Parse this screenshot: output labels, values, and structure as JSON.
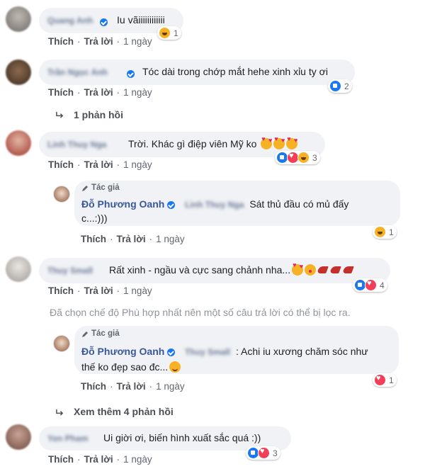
{
  "actions": {
    "like": "Thích",
    "reply": "Trả lời",
    "sep": "·"
  },
  "comments": [
    {
      "author": "Quang Anh",
      "text": "Iu vãiiiiiiiiiiii",
      "time": "1 ngày",
      "reaction_count": "1"
    },
    {
      "author": "Trần Ngọc Anh",
      "text": "Tóc dài trong chớp mắt hehe xinh xỉu ty ơi",
      "time": "1 ngày",
      "reaction_count": "2",
      "replies_link": "1 phản hồi"
    },
    {
      "author": "Linh Thuy Nga",
      "text": "Trời. Khác gì điệp viên Mỹ ko",
      "time": "1 ngày",
      "reaction_count": "3"
    },
    {
      "author": "Thuy Small",
      "text": "Rất xinh - ngầu và cực sang chảnh nha...",
      "time": "1 ngày",
      "reaction_count": "4"
    },
    {
      "author": "Yen Pham",
      "text": "Ui giời ơi, biến hình xuất sắc quá :))",
      "time": "1 ngày",
      "reaction_count": "3"
    }
  ],
  "replies": [
    {
      "tag": "Tác giả",
      "author": "Đỗ Phương Oanh",
      "mention": "Linh Thuy Nga",
      "text_line1": "Sát thủ đầu có mủ đấy",
      "text_line2": "c...:)))",
      "time": "1 ngày",
      "reaction_count": "1"
    },
    {
      "tag": "Tác giả",
      "author": "Đỗ Phương Oanh",
      "mention": "Thuy Small",
      "text_line1": ": Achi iu xương chăm sóc như",
      "text_line2": "thế ko đẹp sao đc...",
      "time": "1 ngày",
      "reaction_count": "1"
    }
  ],
  "filter_notice": "Đã chọn chế độ Phù hợp nhất nên một số câu trả lời có thể bị lọc ra.",
  "more_replies": "Xem thêm 4 phản hồi"
}
